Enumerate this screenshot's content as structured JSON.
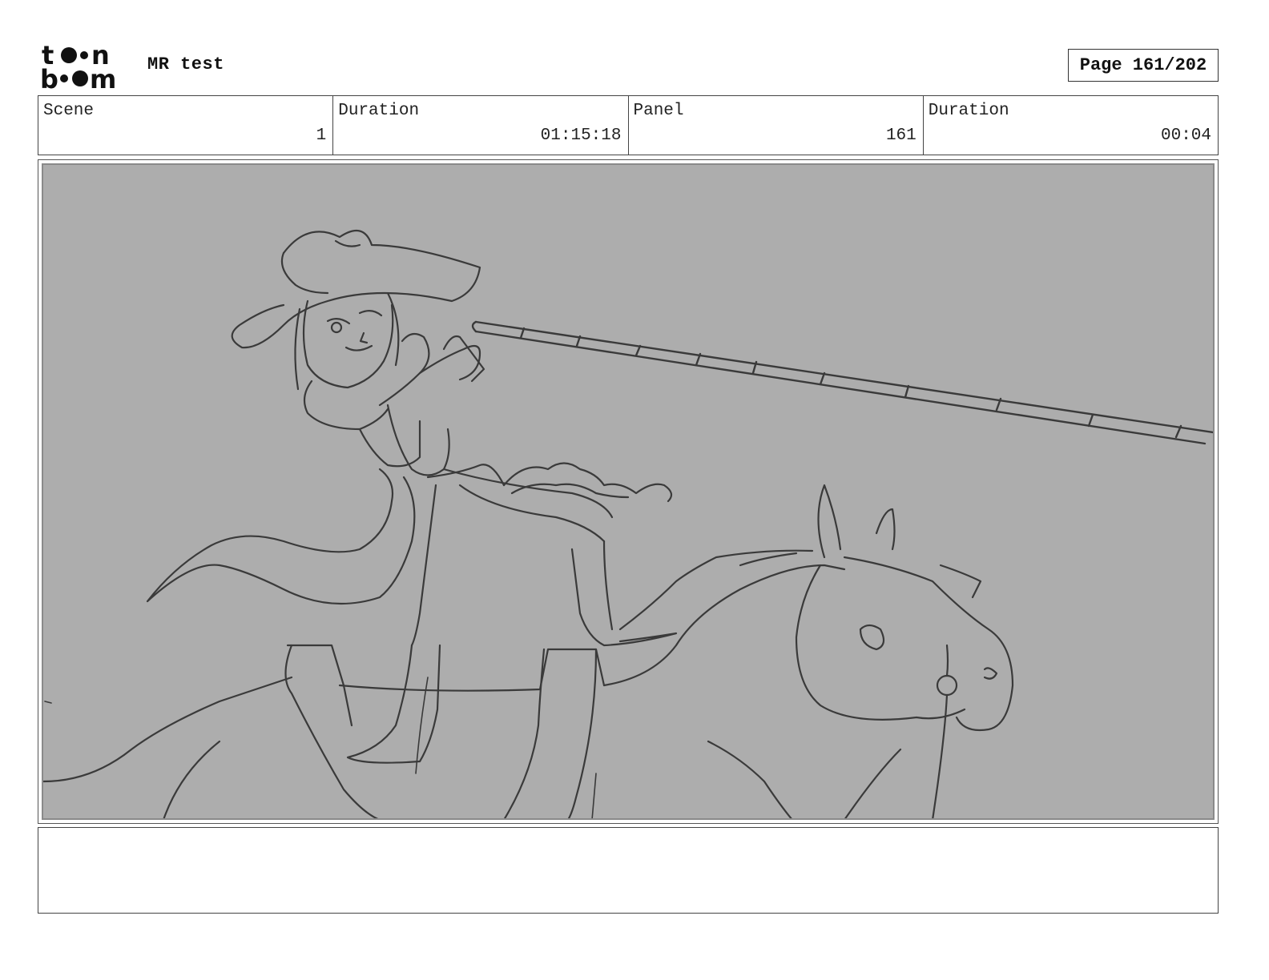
{
  "header": {
    "logo_alt": "toon boom",
    "project_title": "MR test",
    "page_label": "Page 161/202"
  },
  "info": {
    "scene_label": "Scene",
    "scene_value": "1",
    "scene_duration_label": "Duration",
    "scene_duration_value": "01:15:18",
    "panel_label": "Panel",
    "panel_value": "161",
    "panel_duration_label": "Duration",
    "panel_duration_value": "00:04"
  },
  "panel": {
    "background_color": "#adadad",
    "sketch_color": "#3a3a3a"
  },
  "notes": {
    "text": ""
  }
}
